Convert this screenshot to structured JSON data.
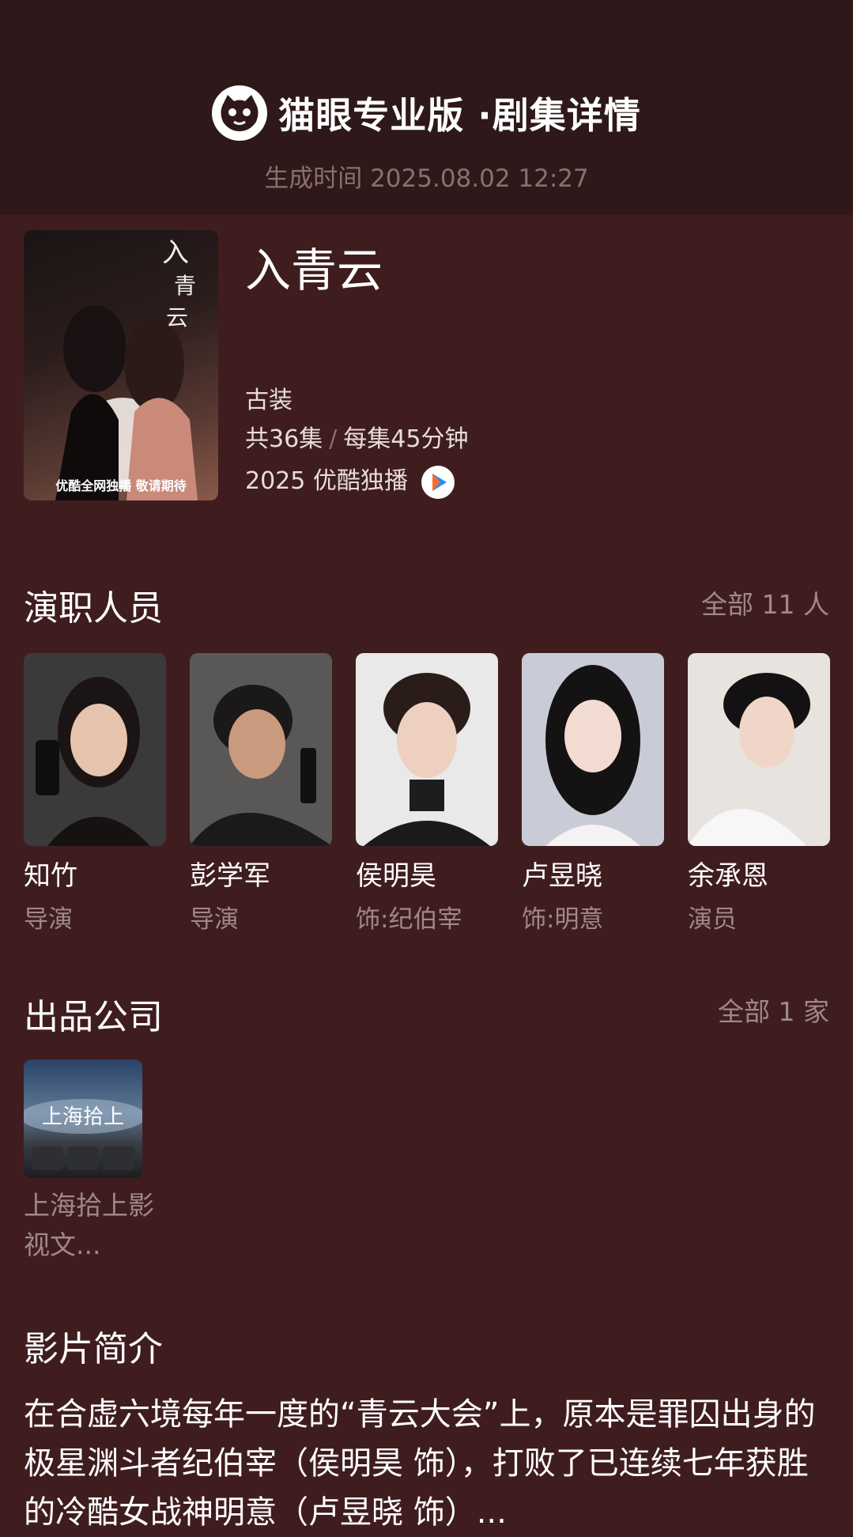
{
  "header": {
    "brand_title": "猫眼专业版 ·剧集详情",
    "generated_time": "生成时间 2025.08.02 12:27"
  },
  "show": {
    "poster_caption": "优酷全网独播 敬请期待",
    "title": "入青云",
    "genre": "古装",
    "episodes": "共36集",
    "separator": "/",
    "duration": "每集45分钟",
    "year_platform": "2025 优酷独播",
    "platform_icon": "youku-icon"
  },
  "cast_section": {
    "title": "演职人员",
    "more": "全部 11 人",
    "members": [
      {
        "name": "知竹",
        "role": "导演"
      },
      {
        "name": "彭学军",
        "role": "导演"
      },
      {
        "name": "侯明昊",
        "role": "饰:纪伯宰"
      },
      {
        "name": "卢昱晓",
        "role": "饰:明意"
      },
      {
        "name": "余承恩",
        "role": "演员"
      }
    ]
  },
  "company_section": {
    "title": "出品公司",
    "more": "全部 1 家",
    "logo_text": "上海拾上",
    "company_name": "上海拾上影视文..."
  },
  "synopsis_section": {
    "title": "影片简介",
    "text": "在合虚六境每年一度的“青云大会”上，原本是罪囚出身的极星渊斗者纪伯宰（侯明昊 饰），打败了已连续七年获胜的冷酷女战神明意（卢昱晓 饰）..."
  },
  "colors": {
    "page_bg": "#3f1d1f",
    "header_bg": "#2f1819",
    "muted_text": "#9f8889"
  }
}
